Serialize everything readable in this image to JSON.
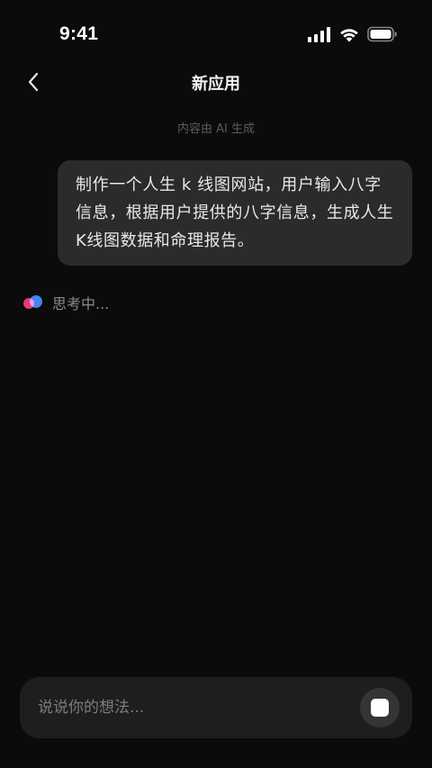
{
  "status_bar": {
    "time": "9:41",
    "icons": [
      "signal-icon",
      "wifi-icon",
      "battery-icon"
    ]
  },
  "header": {
    "title": "新应用",
    "back_icon": "chevron-left-icon"
  },
  "ai_note": "内容由 AI 生成",
  "messages": [
    {
      "role": "user",
      "text": "制作一个人生 k 线图网站，用户输入八字信息，根据用户提供的八字信息，生成人生K线图数据和命理报告。"
    }
  ],
  "thinking": {
    "text": "思考中...",
    "icon": "assistant-logo-icon"
  },
  "input": {
    "placeholder": "说说你的想法...",
    "value": "",
    "send_icon": "stop-icon"
  },
  "colors": {
    "background": "#0b0b0b",
    "bubble": "#2b2b2b",
    "input_bar": "#1e1e1e",
    "logo_pink": "#e6397a",
    "logo_blue": "#3f7df0"
  }
}
